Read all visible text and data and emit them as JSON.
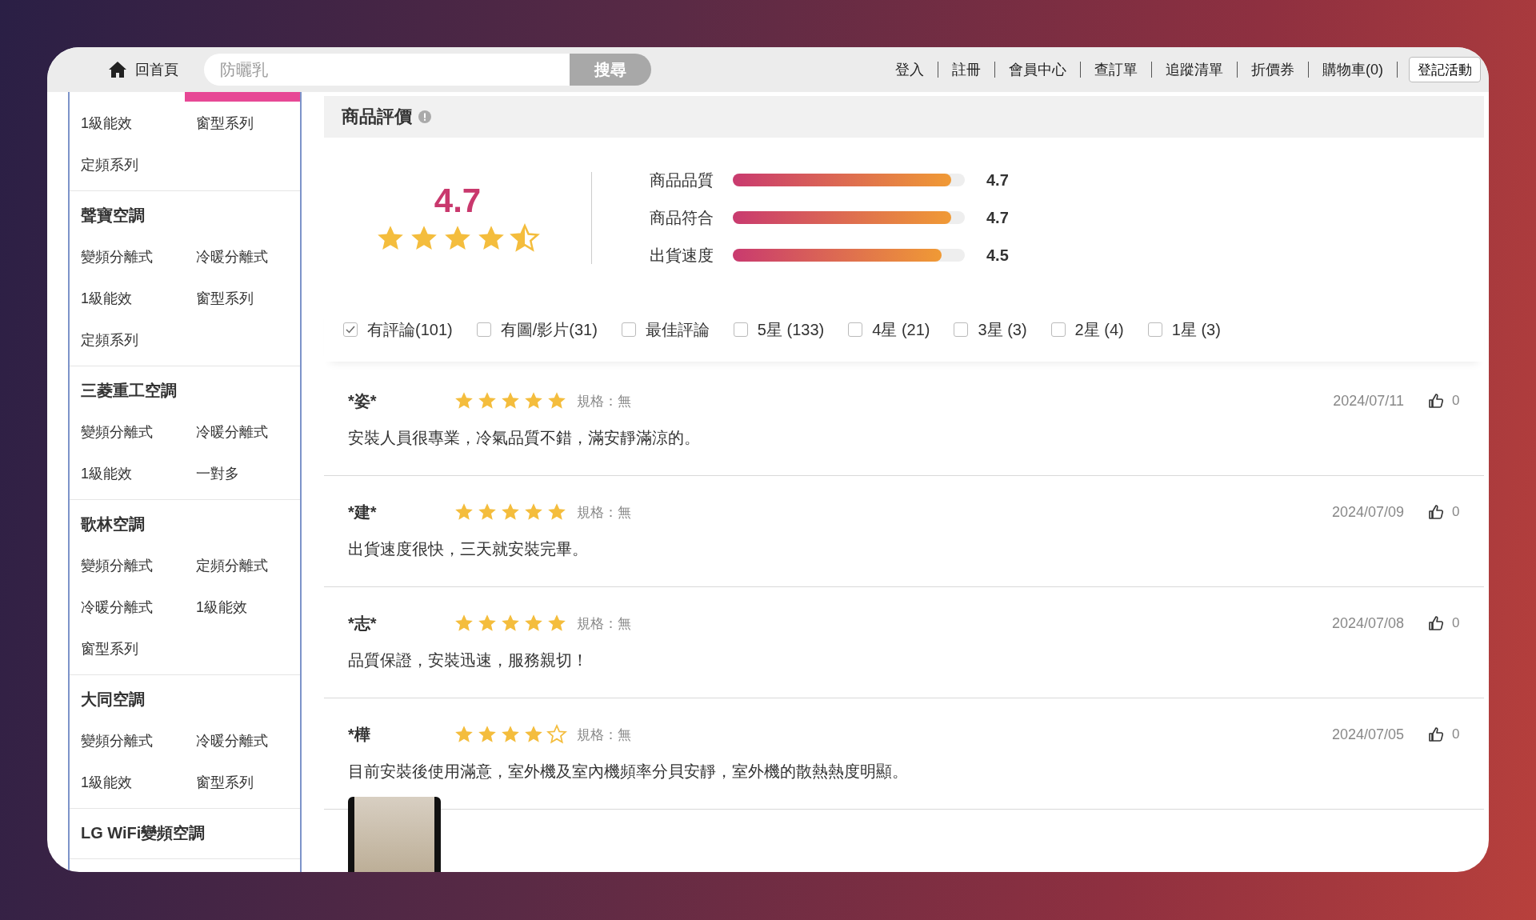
{
  "top_bar": {
    "home": "回首頁",
    "search": {
      "placeholder": "防曬乳",
      "button": "搜尋"
    },
    "nav": [
      "登入",
      "註冊",
      "會員中心",
      "查訂單",
      "追蹤清單",
      "折價券",
      "購物車(0)"
    ],
    "event_button": "登記活動"
  },
  "sidebar": {
    "groups": [
      {
        "items": [
          "1級能效",
          "窗型系列",
          "定頻系列"
        ]
      },
      {
        "title": "聲寶空調",
        "items": [
          "變頻分離式",
          "冷暖分離式",
          "1級能效",
          "窗型系列",
          "定頻系列"
        ]
      },
      {
        "title": "三菱重工空調",
        "items": [
          "變頻分離式",
          "冷暖分離式",
          "1級能效",
          "一對多"
        ]
      },
      {
        "title": "歌林空調",
        "items": [
          "變頻分離式",
          "定頻分離式",
          "冷暖分離式",
          "1級能效",
          "窗型系列"
        ]
      },
      {
        "title": "大同空調",
        "items": [
          "變頻分離式",
          "冷暖分離式",
          "1級能效",
          "窗型系列"
        ]
      },
      {
        "title": "LG WiFi變頻空調"
      }
    ]
  },
  "summary": {
    "title": "商品評價",
    "score": "4.7",
    "stars": 4.5,
    "metrics": [
      {
        "label": "商品品質",
        "level": 0.94,
        "value": "4.7"
      },
      {
        "label": "商品符合",
        "level": 0.94,
        "value": "4.7"
      },
      {
        "label": "出貨速度",
        "level": 0.9,
        "value": "4.5"
      }
    ]
  },
  "filters": [
    {
      "label": "有評論(101)",
      "checked": true
    },
    {
      "label": "有圖/影片(31)",
      "checked": false
    },
    {
      "label": "最佳評論",
      "checked": false
    },
    {
      "label": "5星 (133)",
      "checked": false
    },
    {
      "label": "4星 (21)",
      "checked": false
    },
    {
      "label": "3星 (3)",
      "checked": false
    },
    {
      "label": "2星 (4)",
      "checked": false
    },
    {
      "label": "1星 (3)",
      "checked": false
    }
  ],
  "reviews": [
    {
      "name": "*姿*",
      "stars": 5,
      "spec": "規格：無",
      "date": "2024/07/11",
      "likes": "0",
      "text": "安裝人員很專業，冷氣品質不錯，滿安靜滿涼的。",
      "photo": false
    },
    {
      "name": "*建*",
      "stars": 5,
      "spec": "規格：無",
      "date": "2024/07/09",
      "likes": "0",
      "text": "出貨速度很快，三天就安裝完畢。",
      "photo": false
    },
    {
      "name": "*志*",
      "stars": 5,
      "spec": "規格：無",
      "date": "2024/07/08",
      "likes": "0",
      "text": "品質保證，安裝迅速，服務親切！",
      "photo": false
    },
    {
      "name": "*樺",
      "stars": 4,
      "spec": "規格：無",
      "date": "2024/07/05",
      "likes": "0",
      "text": "目前安裝後使用滿意，室外機及室內機頻率分貝安靜，室外機的散熱熱度明顯。",
      "photo": true
    }
  ]
}
